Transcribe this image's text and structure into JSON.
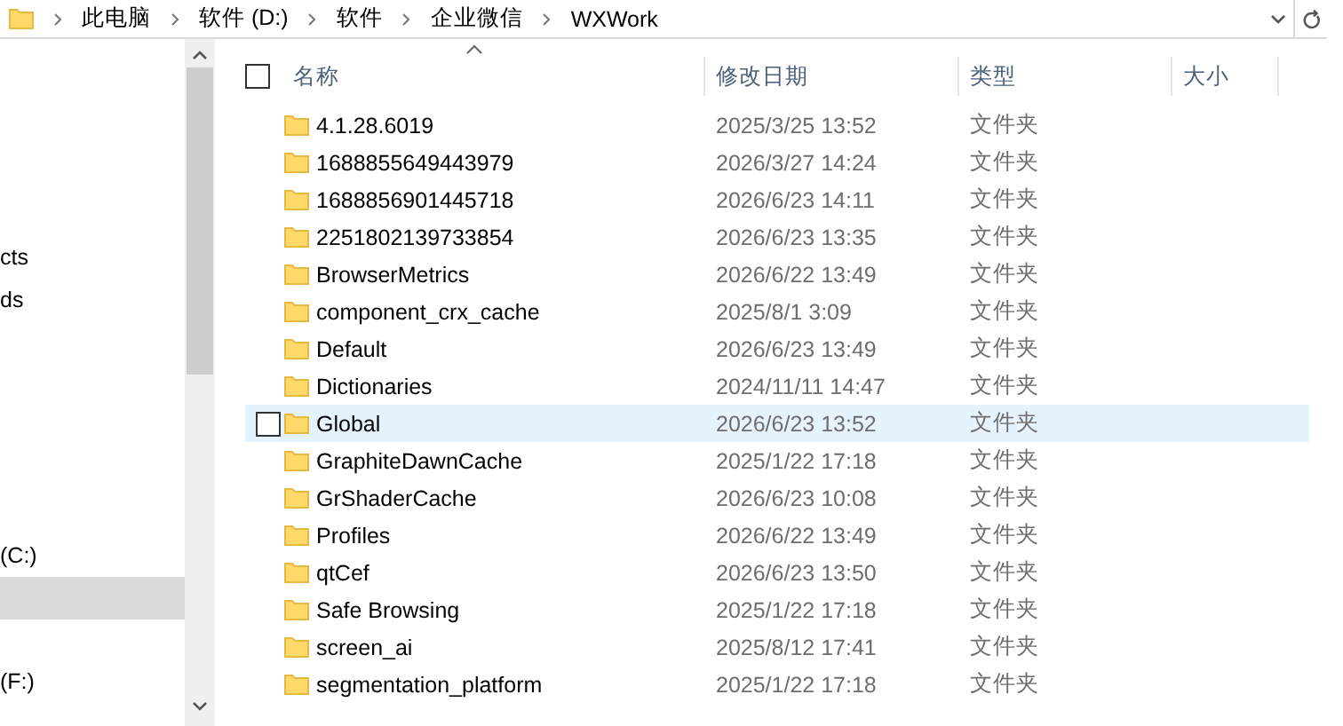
{
  "address_bar": {
    "crumbs": [
      "此电脑",
      "软件 (D:)",
      "软件",
      "企业微信",
      "WXWork"
    ]
  },
  "nav_pane": {
    "sections": [
      {
        "items": [
          {
            "label": "cts",
            "selected": false
          },
          {
            "label": "ds",
            "selected": false
          }
        ]
      },
      {
        "items": [
          {
            "label": "(C:)",
            "selected": false
          },
          {
            "selected": true
          }
        ]
      },
      {
        "items": [
          {
            "label": "(F:)",
            "selected": false
          }
        ]
      }
    ]
  },
  "table": {
    "select_all_checked": false,
    "columns": [
      "名称",
      "修改日期",
      "类型",
      "大小"
    ],
    "rows": [
      {
        "name": "4.1.28.6019",
        "date": "2025/3/25 13:52",
        "type": "文件夹",
        "selected": false
      },
      {
        "name": "1688855649443979",
        "date": "2026/3/27 14:24",
        "type": "文件夹",
        "selected": false
      },
      {
        "name": "1688856901445718",
        "date": "2026/6/23 14:11",
        "type": "文件夹",
        "selected": false
      },
      {
        "name": "2251802139733854",
        "date": "2026/6/23 13:35",
        "type": "文件夹",
        "selected": false
      },
      {
        "name": "BrowserMetrics",
        "date": "2026/6/22 13:49",
        "type": "文件夹",
        "selected": false
      },
      {
        "name": "component_crx_cache",
        "date": "2025/8/1 3:09",
        "type": "文件夹",
        "selected": false
      },
      {
        "name": "Default",
        "date": "2026/6/23 13:49",
        "type": "文件夹",
        "selected": false
      },
      {
        "name": "Dictionaries",
        "date": "2024/11/11 14:47",
        "type": "文件夹",
        "selected": false
      },
      {
        "name": "Global",
        "date": "2026/6/23 13:52",
        "type": "文件夹",
        "selected": true
      },
      {
        "name": "GraphiteDawnCache",
        "date": "2025/1/22 17:18",
        "type": "文件夹",
        "selected": false
      },
      {
        "name": "GrShaderCache",
        "date": "2026/6/23 10:08",
        "type": "文件夹",
        "selected": false
      },
      {
        "name": "Profiles",
        "date": "2026/6/22 13:49",
        "type": "文件夹",
        "selected": false
      },
      {
        "name": "qtCef",
        "date": "2026/6/23 13:50",
        "type": "文件夹",
        "selected": false
      },
      {
        "name": "Safe Browsing",
        "date": "2025/1/22 17:18",
        "type": "文件夹",
        "selected": false
      },
      {
        "name": "screen_ai",
        "date": "2025/8/12 17:41",
        "type": "文件夹",
        "selected": false
      },
      {
        "name": "segmentation_platform",
        "date": "2025/1/22 17:18",
        "type": "文件夹",
        "selected": false
      }
    ]
  }
}
